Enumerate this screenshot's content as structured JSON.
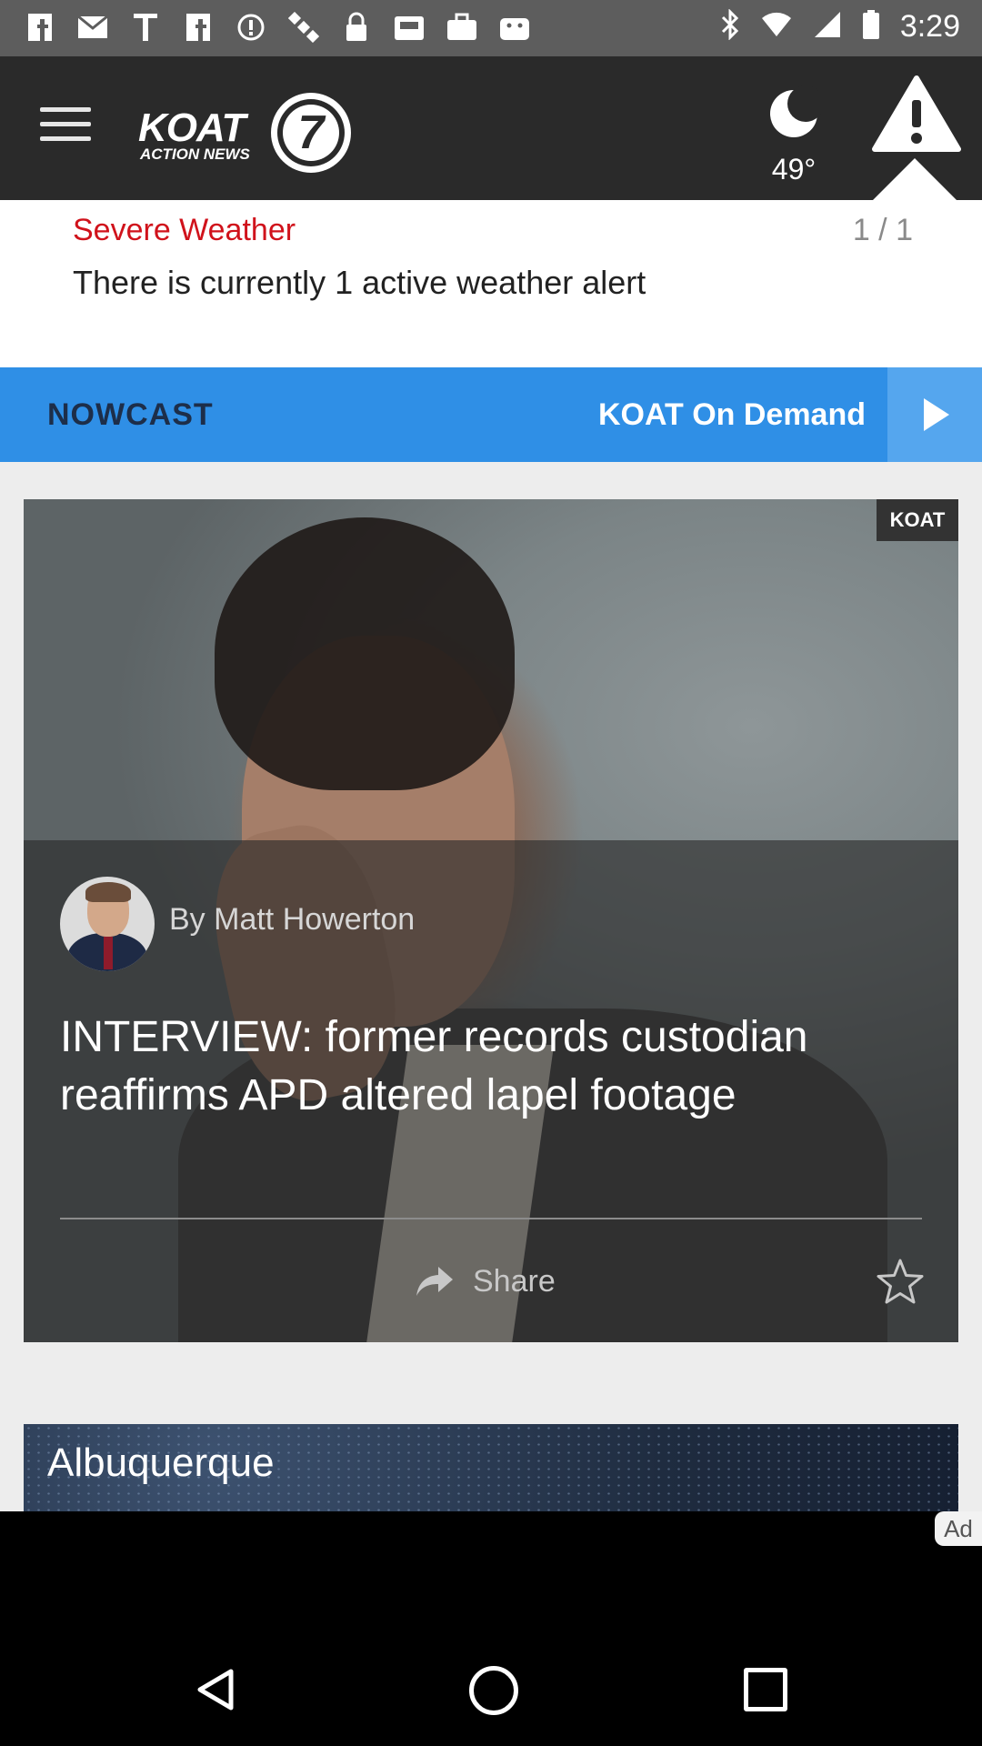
{
  "status_bar": {
    "time": "3:29",
    "left_icons": [
      "facebook-icon",
      "gmail-icon",
      "text-icon",
      "facebook-icon",
      "alert-circle-icon",
      "satellite-icon",
      "lock-icon",
      "inbox-icon",
      "briefcase-icon",
      "android-icon"
    ],
    "right_icons": [
      "bluetooth-icon",
      "wifi-icon",
      "signal-icon",
      "battery-icon"
    ]
  },
  "header": {
    "logo_call": "KOAT",
    "logo_tag": "ACTION NEWS",
    "logo_number": "7",
    "weather_icon": "moon-icon",
    "temperature": "49°",
    "alert_icon": "warning-triangle-icon"
  },
  "alert": {
    "title": "Severe Weather",
    "count": "1 / 1",
    "message": "There is currently 1 active weather alert"
  },
  "nav": {
    "nowcast_label": "NOWCAST",
    "on_demand_label": "KOAT On Demand"
  },
  "story": {
    "source_badge": "KOAT",
    "byline": "By Matt Howerton",
    "headline": "INTERVIEW: former records custodian reaffirms APD altered lapel footage",
    "share_label": "Share"
  },
  "next_story": {
    "title": "Albuquerque"
  },
  "ad": {
    "badge": "Ad"
  },
  "colors": {
    "header_bg": "#2a2a2a",
    "alert_red": "#d0121b",
    "nav_blue": "#2f8fe6",
    "nowcast_text": "#1d2e49"
  }
}
